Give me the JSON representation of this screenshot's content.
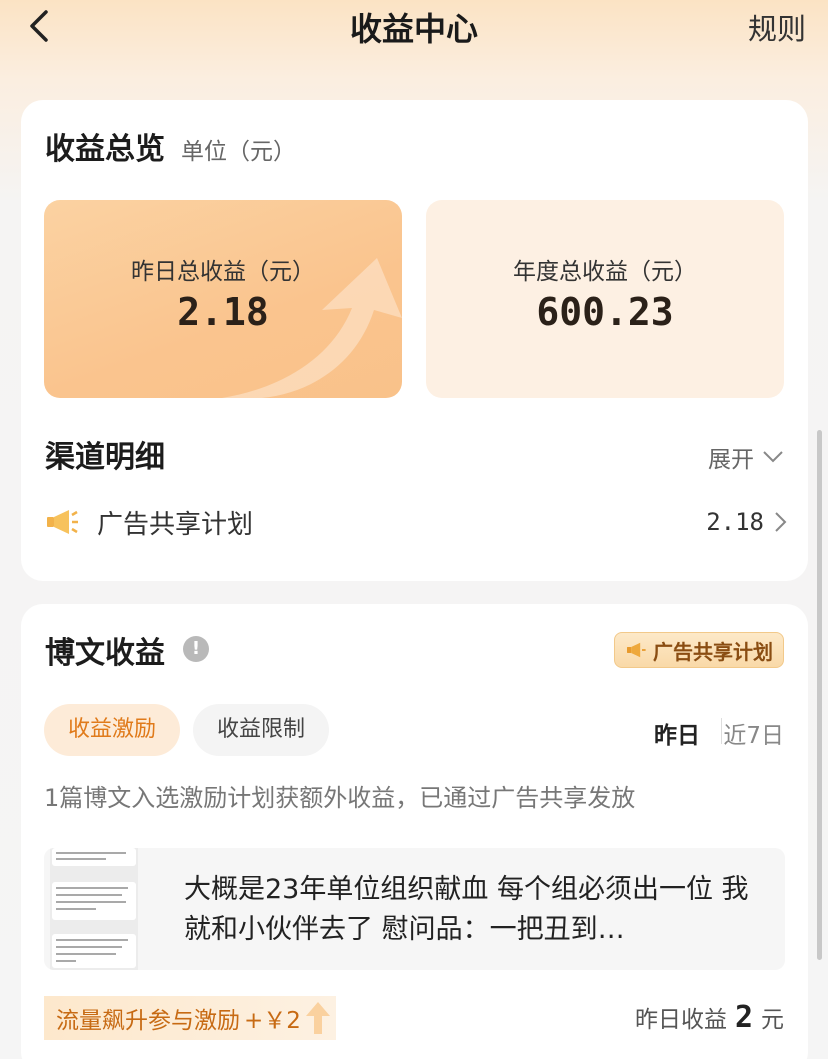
{
  "header": {
    "title": "收益中心",
    "rules": "规则"
  },
  "overview": {
    "title": "收益总览",
    "unit": "单位（元）",
    "yesterday_label": "昨日总收益（元）",
    "yesterday_value": "2.18",
    "year_label": "年度总收益（元）",
    "year_value": "600.23"
  },
  "channels": {
    "title": "渠道明细",
    "expand": "展开",
    "items": [
      {
        "name": "广告共享计划",
        "value": "2.18"
      }
    ]
  },
  "blog": {
    "title": "博文收益",
    "badge": "广告共享计划",
    "tabs": [
      "收益激励",
      "收益限制"
    ],
    "periods": [
      "昨日",
      "近7日"
    ],
    "description": "1篇博文入选激励计划获额外收益，已通过广告共享发放",
    "post_text": "大概是23年单位组织献血 每个组必须出一位 我就和小伙伴去了 慰问品：一把丑到…",
    "incentive_text": "流量飙升参与激励",
    "incentive_amount": "+￥2",
    "yesterday_income_label": "昨日收益",
    "yesterday_income_value": "2",
    "yesterday_income_unit": "元"
  },
  "colors": {
    "accent": "#e07a1a",
    "badge_text": "#8a4d12",
    "highlight_card": "#fac48e"
  }
}
